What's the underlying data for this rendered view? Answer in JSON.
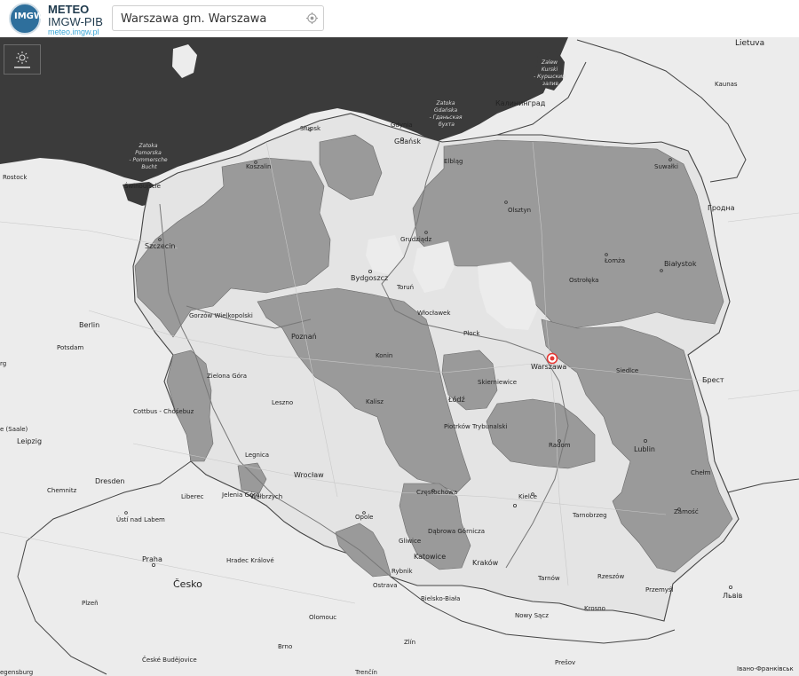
{
  "header": {
    "logo_text": "IMGW",
    "brand_line1": "METEO",
    "brand_line2": "IMGW-PIB",
    "brand_line3": "meteo.imgw.pl"
  },
  "search": {
    "value": "Warszawa gm. Warszawa"
  },
  "icons": {
    "logo": "logo-icon",
    "locate": "locate-icon",
    "layers": "weather-layer-icon",
    "marker": "location-marker-icon"
  },
  "colors": {
    "water": "#3b3b3b",
    "land": "#ececec",
    "warning_area": "#9a9a9a",
    "marker": "#e53935",
    "accent": "#3aa6d6"
  },
  "map": {
    "sea_labels": [
      {
        "id": "zatoka-pomorska",
        "lines": [
          "Zatoka",
          "Pomorska",
          "- Pommersche",
          "Bucht"
        ]
      },
      {
        "id": "zatoka-gdanska",
        "lines": [
          "Zatoka",
          "Gdańska",
          "- Гданьская",
          "бухта"
        ]
      },
      {
        "id": "zalew-kurski",
        "lines": [
          "Zalew",
          "Kurski",
          "- Куршский",
          "залив"
        ]
      }
    ],
    "countries": [
      {
        "id": "cesko",
        "label": "Česko"
      },
      {
        "id": "lietuva",
        "label": "Lietuva"
      }
    ],
    "cities": {
      "warszawa": "Warszawa",
      "gdansk": "Gdańsk",
      "gdynia": "Gdynia",
      "slupsk": "Słupsk",
      "koszalin": "Koszalin",
      "szczecin": "Szczecin",
      "swinoujscie": "Świnoujście",
      "kaliningrad": "Калининград",
      "elblag": "Elbląg",
      "olsztyn": "Olsztyn",
      "suwalki": "Suwałki",
      "bialystok": "Białystok",
      "lomza": "Łomża",
      "ostroleka": "Ostrołęka",
      "grudziadz": "Grudziądz",
      "bydgoszcz": "Bydgoszcz",
      "torun": "Toruń",
      "wloclawek": "Włocławek",
      "plock": "Płock",
      "gorzow": "Gorzów Wielkopolski",
      "poznan": "Poznań",
      "konin": "Konin",
      "kalisz": "Kalisz",
      "lodz": "Łódź",
      "skierniewice": "Skierniewice",
      "siedlce": "Siedlce",
      "brest": "Брест",
      "grodno": "Гродна",
      "kaunas": "Kaunas",
      "berlin": "Berlin",
      "potsdam": "Potsdam",
      "zielona": "Zielona Góra",
      "leszno": "Leszno",
      "cottbus": "Cottbus - Chóśebuz",
      "leipzig": "Leipzig",
      "dresden": "Dresden",
      "chemnitz": "Chemnitz",
      "legnica": "Legnica",
      "wroclaw": "Wrocław",
      "jelenia": "Jelenia Góra",
      "walbrzych": "Wałbrzych",
      "liberec": "Liberec",
      "piotrkow": "Piotrków Trybunalski",
      "radom": "Radom",
      "lublin": "Lublin",
      "chelm": "Chełm",
      "zamosc": "Zamość",
      "kielce": "Kielce",
      "tarnobrzeg": "Tarnobrzeg",
      "czestochowa": "Częstochowa",
      "opole": "Opole",
      "gliwice": "Gliwice",
      "katowice": "Katowice",
      "dabrowa": "Dąbrowa Górnicza",
      "krakow": "Kraków",
      "rybnik": "Rybnik",
      "ostrava": "Ostrava",
      "bielsko": "Bielsko-Biała",
      "tarnow": "Tarnów",
      "rzeszow": "Rzeszów",
      "przemysl": "Przemyśl",
      "lviv": "Львів",
      "nowysacz": "Nowy Sącz",
      "krosno": "Krosno",
      "olomouc": "Olomouc",
      "praha": "Praha",
      "hradec": "Hradec Králové",
      "usti": "Ústí nad Labem",
      "plzen": "Plzeň",
      "brno": "Brno",
      "zlin": "Zlín",
      "presov": "Prešov",
      "budejovice": "České Budějovice",
      "frankivsk": "Івано-Франківськ",
      "rostock": "Rostock",
      "halle": "e (Saale)",
      "hamburg_frag": "rg",
      "regensburg": "egensburg",
      "trencin": "Trenčín"
    }
  }
}
